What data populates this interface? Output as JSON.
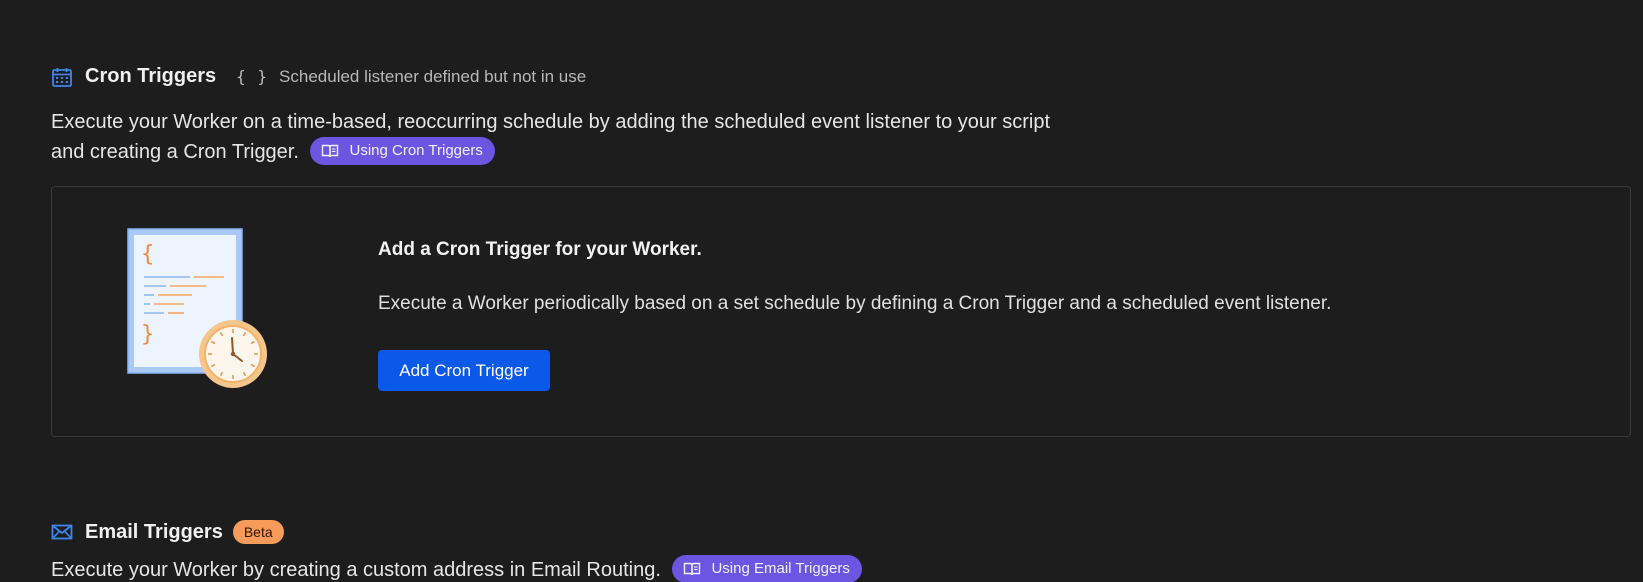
{
  "cron": {
    "icon": "calendar-icon",
    "title": "Cron Triggers",
    "status_braces": "{ }",
    "status_text": "Scheduled listener defined but not in use",
    "description_line1": "Execute your Worker on a time-based, reoccurring schedule by adding the scheduled event listener to your script",
    "description_line2": "and creating a Cron Trigger.",
    "doc_link_label": "Using Cron Triggers",
    "card": {
      "heading": "Add a Cron Trigger for your Worker.",
      "text": "Execute a Worker periodically based on a set schedule by defining a Cron Trigger and a scheduled event listener.",
      "button_label": "Add Cron Trigger",
      "illustration": "document-with-clock-illustration"
    }
  },
  "email": {
    "icon": "envelope-icon",
    "title": "Email Triggers",
    "badge": "Beta",
    "description": "Execute your Worker by creating a custom address in Email Routing.",
    "doc_link_label": "Using Email Triggers"
  },
  "colors": {
    "background": "#1d1d1d",
    "accent_blue": "#0a59e8",
    "doc_pill": "#6c55e0",
    "beta_badge": "#f79a5a"
  }
}
